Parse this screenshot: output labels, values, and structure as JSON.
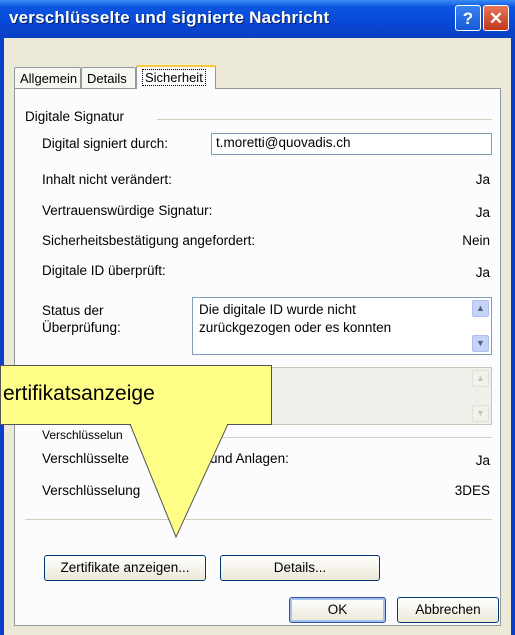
{
  "window": {
    "title": "verschlüsselte und signierte Nachricht",
    "help_glyph": "?",
    "close_glyph": "✕"
  },
  "tabs": [
    {
      "label": "Allgemein"
    },
    {
      "label": "Details"
    },
    {
      "label": "Sicherheit"
    }
  ],
  "signature": {
    "group_label": "Digitale Signatur",
    "signed_by_label": "Digital signiert durch:",
    "signed_by_value": "t.moretti@quovadis.ch",
    "rows": [
      {
        "label": "Inhalt nicht verändert:",
        "value": "Ja"
      },
      {
        "label": "Vertrauenswürdige Signatur:",
        "value": "Ja"
      },
      {
        "label": "Sicherheitsbestätigung angefordert:",
        "value": "Nein"
      },
      {
        "label": "Digitale ID überprüft:",
        "value": "Ja"
      }
    ],
    "status_label_line1": "Status der",
    "status_label_line2": "Überprüfung:",
    "status_text_line1": "Die digitale ID wurde nicht",
    "status_text_line2": "zurückgezogen oder es konnten"
  },
  "encryption": {
    "group_label_partial": "Verschlüsselun",
    "rows": [
      {
        "label_left": "Verschlüsselte",
        "label_right": "und Anlagen:",
        "value": "Ja"
      },
      {
        "label_left": "Verschlüsselung",
        "value": "3DES"
      }
    ]
  },
  "buttons": {
    "show_certificates": "Zertifikate anzeigen...",
    "details": "Details...",
    "ok": "OK",
    "cancel": "Abbrechen"
  },
  "callout": {
    "text": "ertifikatsanzeige"
  },
  "colors": {
    "titlebar": "#0848d6",
    "dialog_bg": "#ece9d8",
    "callout_fill": "#ffff88",
    "active_tab_accent": "#ffc83c"
  }
}
